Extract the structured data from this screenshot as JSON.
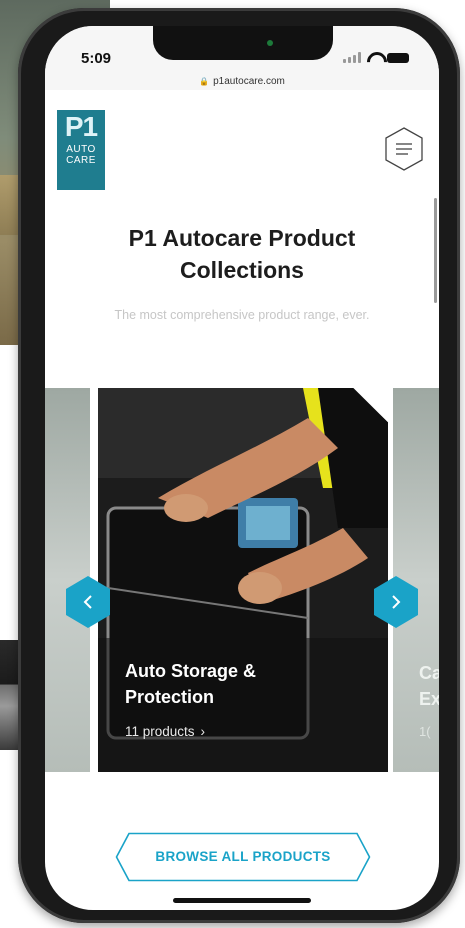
{
  "status_bar": {
    "time": "5:09",
    "url": "p1autocare.com"
  },
  "header": {
    "logo": {
      "main": "P1",
      "line1": "AUTO",
      "line2": "CARE"
    }
  },
  "hero": {
    "title_line1": "P1 Autocare Product",
    "title_line2": "Collections",
    "subtitle": "The most comprehensive product range, ever."
  },
  "carousel": {
    "active_card": {
      "title_line1": "Auto Storage &",
      "title_line2": "Protection",
      "count": "11 products"
    },
    "next_card": {
      "title_line1": "Ca",
      "title_line2": "Ex",
      "count": "1("
    }
  },
  "browse_button": {
    "label": "BROWSE ALL PRODUCTS"
  },
  "colors": {
    "accent": "#1aa3c8",
    "logo_bg": "#1f7d8f",
    "subtitle": "#c6c6c6",
    "title": "#1d1d1d"
  },
  "icons": {
    "menu": "hamburger-hexagon-icon",
    "prev": "chevron-left-icon",
    "next": "chevron-right-icon",
    "lock": "lock-icon"
  }
}
